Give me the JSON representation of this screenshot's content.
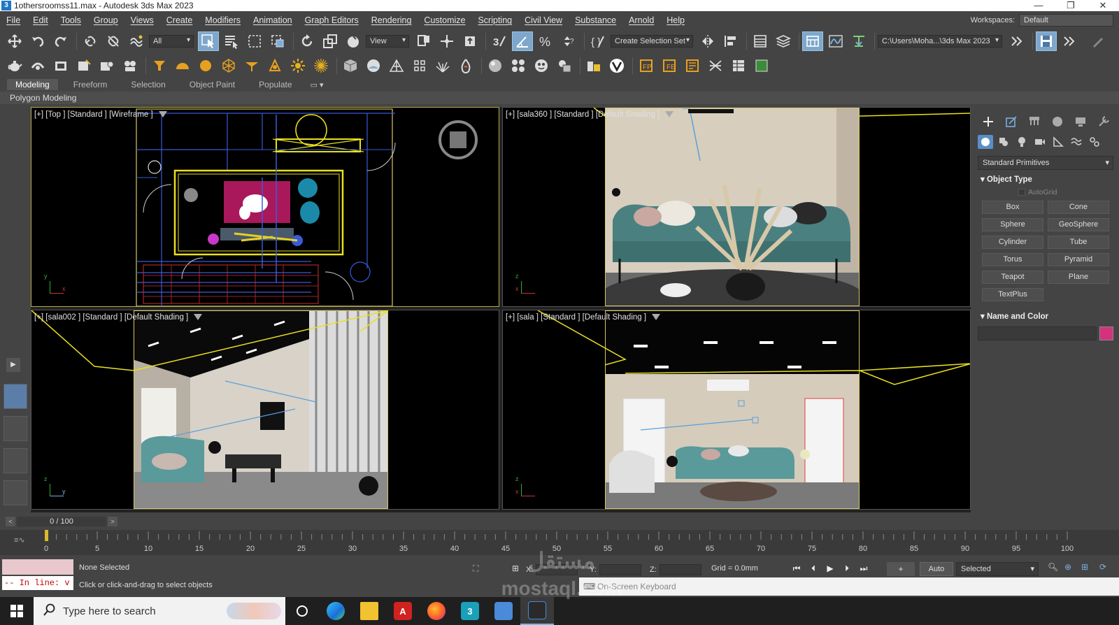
{
  "window": {
    "title": "1othersroomss11.max - Autodesk 3ds Max 2023",
    "app_icon": "3"
  },
  "menu": [
    "File",
    "Edit",
    "Tools",
    "Group",
    "Views",
    "Create",
    "Modifiers",
    "Animation",
    "Graph Editors",
    "Rendering",
    "Customize",
    "Scripting",
    "Civil View",
    "Substance",
    "Arnold",
    "Help"
  ],
  "workspace": {
    "label": "Workspaces:",
    "value": "Default"
  },
  "toolbar": {
    "selection_filter": "All",
    "ref_coord": "View",
    "named_selection": "Create Selection Set",
    "project_path": "C:\\Users\\Moha...\\3ds Max 2023"
  },
  "ribbon": {
    "tabs": [
      "Modeling",
      "Freeform",
      "Selection",
      "Object Paint",
      "Populate"
    ],
    "active_tab": "Modeling",
    "sub": "Polygon Modeling"
  },
  "viewports": {
    "top_left": "[+] [Top ] [Standard ] [Wireframe ]",
    "top_right": "[+] [sala360 ] [Standard ] [Default Shading ]",
    "bottom_left": "[+] [sala002 ] [Standard ] [Default Shading ]",
    "bottom_right": "[+] [sala ] [Standard ] [Default Shading ]"
  },
  "command_panel": {
    "category": "Standard Primitives",
    "object_type_title": "Object Type",
    "autogrid": "AutoGrid",
    "primitives": [
      "Box",
      "Cone",
      "Sphere",
      "GeoSphere",
      "Cylinder",
      "Tube",
      "Torus",
      "Pyramid",
      "Teapot",
      "Plane",
      "TextPlus"
    ],
    "name_color_title": "Name and Color",
    "swatch_color": "#d4327e"
  },
  "timeslider": {
    "frame": "0 / 100"
  },
  "trackbar": {
    "ticks": [
      "0",
      "5",
      "10",
      "15",
      "20",
      "25",
      "30",
      "35",
      "40",
      "45",
      "50",
      "55",
      "60",
      "65",
      "70",
      "75",
      "80",
      "85",
      "90",
      "95",
      "100"
    ]
  },
  "status": {
    "maxscript": "-- In line: v",
    "selection": "None Selected",
    "prompt": "Click or click-and-drag to select objects",
    "x_label": "X:",
    "y_label": "Y:",
    "z_label": "Z:",
    "grid": "Grid = 0.0mm",
    "auto_key": "Auto",
    "key_filter": "Selected"
  },
  "osk": "On-Screen Keyboard",
  "watermark": {
    "line1": "مستقل",
    "line2": "mostaql.com"
  },
  "taskbar": {
    "search_placeholder": "Type here to search",
    "max_icon_label": "3",
    "acrobat_icon_label": "A"
  }
}
